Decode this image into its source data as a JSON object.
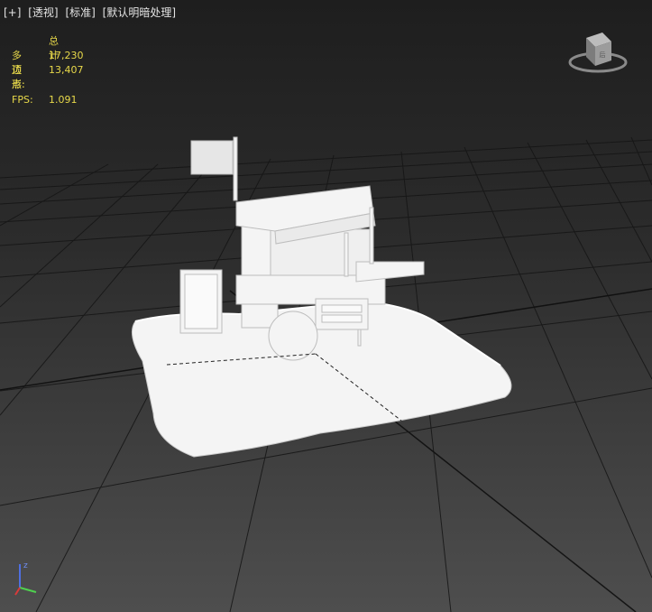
{
  "viewport": {
    "label_plus": "[+]",
    "label_view": "[透视]",
    "label_shading": "[标准]",
    "label_lighting": "[默认明暗处理]"
  },
  "stats": {
    "header": "总计",
    "polygons_label": "多边形:",
    "polygons_value": "17,230",
    "vertices_label": "顶点:",
    "vertices_value": "13,407",
    "fps_label": "FPS:",
    "fps_value": "1.091"
  },
  "viewcube": {
    "face_label": "后"
  },
  "axes": {
    "z_label": "z"
  },
  "colors": {
    "stats_text": "#e8d94a",
    "model_fill": "#f4f4f4",
    "grid_line": "#1a1a1a",
    "axis_x": "#d83a3a",
    "axis_y": "#4fd14f",
    "axis_z": "#4f6fe0"
  }
}
